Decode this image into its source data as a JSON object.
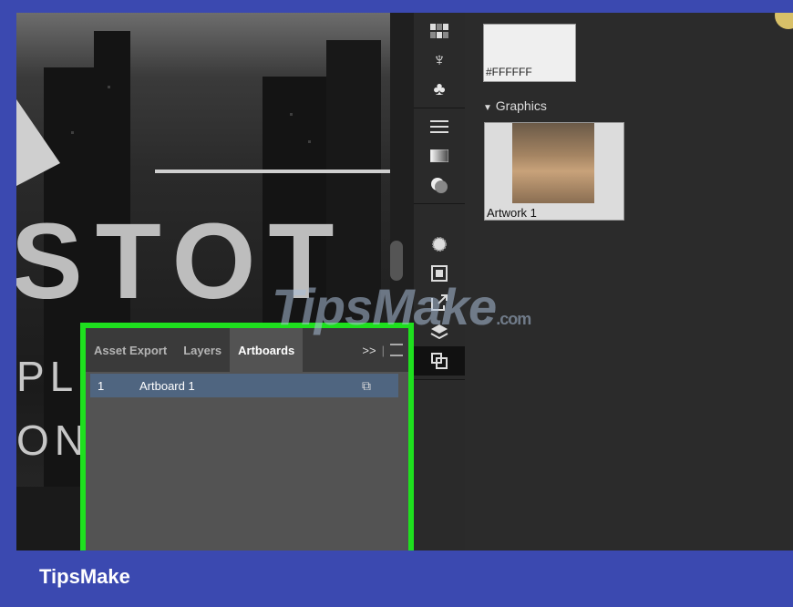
{
  "canvas": {
    "big_text": "STOT",
    "side_letters_1": "PL",
    "side_letters_2": "ON"
  },
  "toolbar": {
    "icons": [
      "grid-icon",
      "puppet-icon",
      "club-icon",
      "stroke-lines-icon",
      "gradient-icon",
      "pathfinder-icon",
      "sun-icon",
      "transform-icon",
      "export-icon",
      "layers-icon",
      "artboards-icon"
    ]
  },
  "right_panel": {
    "swatch_hex": "#FFFFFF",
    "graphics_section": "Graphics",
    "graphic_item": "Artwork 1"
  },
  "artboards_panel": {
    "tabs": [
      "Asset Export",
      "Layers",
      "Artboards"
    ],
    "active_tab": "Artboards",
    "more": ">>",
    "rows": [
      {
        "number": "1",
        "name": "Artboard 1"
      }
    ],
    "highlight_color": "#1ee01e"
  },
  "watermark": {
    "text": "TipsMake",
    "suffix": ".com"
  },
  "footer": {
    "brand": "TipsMake"
  },
  "colors": {
    "brand_bar": "#3b49b0",
    "panel_bg": "#535353",
    "selected_row": "#4f6580"
  }
}
